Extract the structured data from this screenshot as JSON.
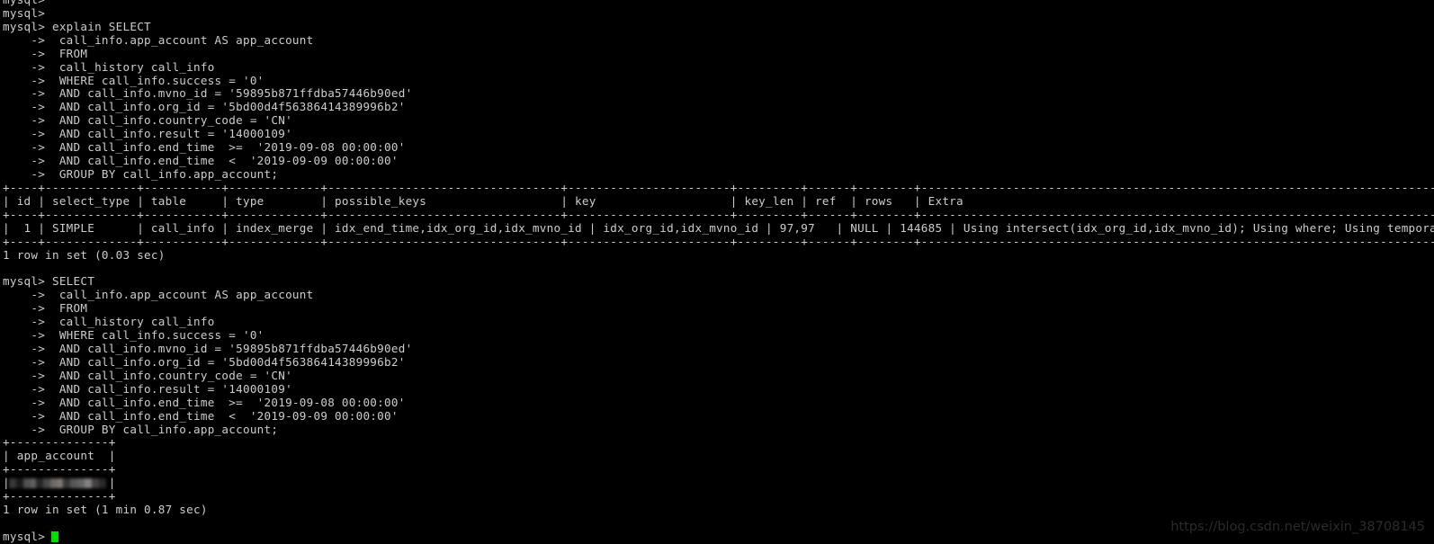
{
  "terminal": {
    "title": "mysql client terminal",
    "background_color": "#000000",
    "text_color": "#cdcdcd",
    "cursor_color": "#00e000",
    "prompt": "mysql>",
    "continuation_prompt": "    ->"
  },
  "lines": [
    "mysql>",
    "mysql>",
    "mysql> explain SELECT",
    "    ->  call_info.app_account AS app_account",
    "    ->  FROM",
    "    ->  call_history call_info",
    "    ->  WHERE call_info.success = '0'",
    "    ->  AND call_info.mvno_id = '59895b871ffdba57446b90ed'",
    "    ->  AND call_info.org_id = '5bd00d4f56386414389996b2'",
    "    ->  AND call_info.country_code = 'CN'",
    "    ->  AND call_info.result = '14000109'",
    "    ->  AND call_info.end_time  >=  '2019-09-08 00:00:00'",
    "    ->  AND call_info.end_time  <  '2019-09-09 00:00:00'",
    "    ->  GROUP BY call_info.app_account;",
    "+----+-------------+-----------+-------------+---------------------------------+-----------------------+---------+------+--------+---------------------------------------------------------------------------------+",
    "| id | select_type | table     | type        | possible_keys                   | key                   | key_len | ref  | rows   | Extra                                                                            |",
    "+----+-------------+-----------+-------------+---------------------------------+-----------------------+---------+------+--------+---------------------------------------------------------------------------------+",
    "|  1 | SIMPLE      | call_info | index_merge | idx_end_time,idx_org_id,idx_mvno_id | idx_org_id,idx_mvno_id | 97,97   | NULL | 144685 | Using intersect(idx_org_id,idx_mvno_id); Using where; Using temporary; Using filesort |",
    "+----+-------------+-----------+-------------+---------------------------------+-----------------------+---------+------+--------+---------------------------------------------------------------------------------+",
    "1 row in set (0.03 sec)",
    "",
    "mysql> SELECT",
    "    ->  call_info.app_account AS app_account",
    "    ->  FROM",
    "    ->  call_history call_info",
    "    ->  WHERE call_info.success = '0'",
    "    ->  AND call_info.mvno_id = '59895b871ffdba57446b90ed'",
    "    ->  AND call_info.org_id = '5bd00d4f56386414389996b2'",
    "    ->  AND call_info.country_code = 'CN'",
    "    ->  AND call_info.result = '14000109'",
    "    ->  AND call_info.end_time  >=  '2019-09-08 00:00:00'",
    "    ->  AND call_info.end_time  <  '2019-09-09 00:00:00'",
    "    ->  GROUP BY call_info.app_account;",
    "+--------------+",
    "| app_account  |",
    "+--------------+",
    "REDACTED_ROW",
    "+--------------+",
    "1 row in set (1 min 0.87 sec)",
    "",
    "PROMPT_CURSOR"
  ],
  "explain_result": {
    "columns": [
      "id",
      "select_type",
      "table",
      "type",
      "possible_keys",
      "key",
      "key_len",
      "ref",
      "rows",
      "Extra"
    ],
    "rows": [
      {
        "id": "1",
        "select_type": "SIMPLE",
        "table": "call_info",
        "type": "index_merge",
        "possible_keys": "idx_end_time,idx_org_id,idx_mvno_id",
        "key": "idx_org_id,idx_mvno_id",
        "key_len": "97,97",
        "ref": "NULL",
        "rows": "144685",
        "Extra": "Using intersect(idx_org_id,idx_mvno_id); Using where; Using temporary; Using filesort"
      }
    ],
    "status": "1 row in set (0.03 sec)"
  },
  "select_result": {
    "columns": [
      "app_account"
    ],
    "rows": [
      {
        "app_account": ""
      }
    ],
    "row_redacted": true,
    "status": "1 row in set (1 min 0.87 sec)"
  },
  "query_sql": [
    "explain SELECT",
    "call_info.app_account AS app_account",
    "FROM",
    "call_history call_info",
    "WHERE call_info.success = '0'",
    "AND call_info.mvno_id = '59895b871ffdba57446b90ed'",
    "AND call_info.org_id = '5bd00d4f56386414389996b2'",
    "AND call_info.country_code = 'CN'",
    "AND call_info.result = '14000109'",
    "AND call_info.end_time  >=  '2019-09-08 00:00:00'",
    "AND call_info.end_time  <  '2019-09-09 00:00:00'",
    "GROUP BY call_info.app_account;"
  ],
  "watermark": {
    "text": "https://blog.csdn.net/weixin_38708145",
    "color": "#2b2b2b"
  }
}
